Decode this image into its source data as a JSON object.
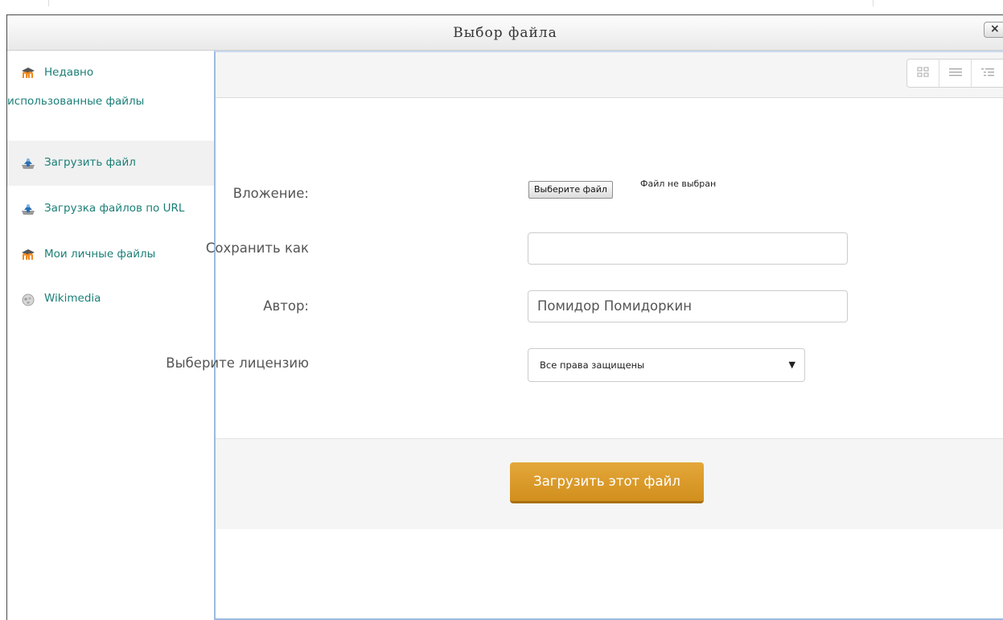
{
  "dialog": {
    "title": "Выбор файла",
    "close_label": "×"
  },
  "sidebar": {
    "items": [
      {
        "label_line1": "Недавно",
        "label_line2": "использованные файлы",
        "icon": "moodle-icon"
      },
      {
        "label": "Загрузить файл",
        "icon": "upload-icon",
        "active": true
      },
      {
        "label": "Загрузка файлов по URL",
        "icon": "url-upload-icon"
      },
      {
        "label": "Мои личные файлы",
        "icon": "moodle-icon"
      },
      {
        "label": "Wikimedia",
        "icon": "wikimedia-icon"
      }
    ]
  },
  "toolbar": {
    "view_modes": [
      "icons-view-icon",
      "list-view-icon",
      "tree-view-icon"
    ]
  },
  "form": {
    "attachment_label": "Вложение:",
    "choose_file_button": "Выберите файл",
    "file_status": "Файл не выбран",
    "save_as_label": "Сохранить как",
    "save_as_value": "",
    "author_label": "Автор:",
    "author_value": "Помидор Помидоркин",
    "license_label": "Выберите лицензию",
    "license_value": "Все права защищены"
  },
  "footer": {
    "submit_label": "Загрузить этот файл"
  },
  "colors": {
    "link": "#1a7f77",
    "accent_button": "#d99a2b",
    "content_border": "#9bbbe0"
  }
}
